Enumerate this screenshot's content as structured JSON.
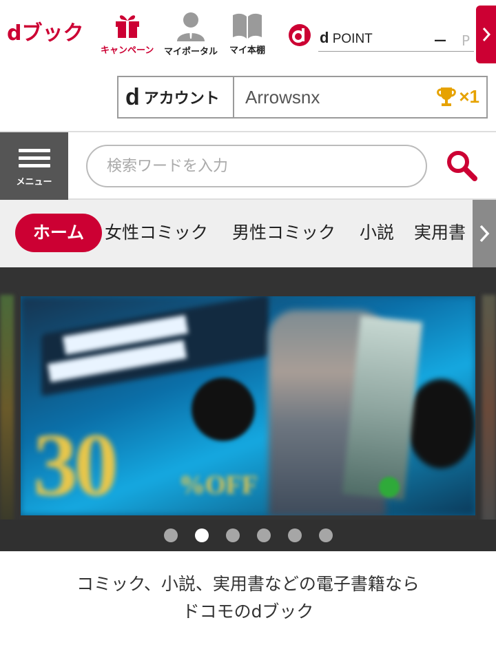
{
  "header": {
    "logo_text": "dブック",
    "nav": {
      "campaign_label": "キャンペーン",
      "portal_label": "マイポータル",
      "shelf_label": "マイ本棚"
    },
    "dpoint": {
      "label_prefix": "d",
      "label": "POINT",
      "value": "—",
      "unit": "P"
    }
  },
  "account": {
    "label_prefix": "d",
    "label": "アカウント",
    "username": "Arrowsnx",
    "trophy_count": "×1"
  },
  "search": {
    "menu_label": "メニュー",
    "placeholder": "検索ワードを入力"
  },
  "tabs": [
    {
      "label": "ホーム",
      "active": true
    },
    {
      "label": "女性コミック",
      "active": false
    },
    {
      "label": "男性コミック",
      "active": false
    },
    {
      "label": "小説",
      "active": false
    },
    {
      "label": "実用書",
      "active": false
    }
  ],
  "carousel": {
    "slide_count": 6,
    "active_index": 1,
    "banner": {
      "percent": "30",
      "off": "%OFF"
    }
  },
  "tagline": {
    "line1": "コミック、小説、実用書などの電子書籍なら",
    "line2": "ドコモのdブック"
  },
  "colors": {
    "brand_red": "#cc0033",
    "menu_gray": "#555555",
    "trophy_gold": "#e6a200"
  },
  "icons": {
    "campaign": "gift-icon",
    "portal": "user-icon",
    "shelf": "book-icon",
    "search": "magnifier-icon",
    "menu": "hamburger-icon",
    "trophy": "trophy-icon"
  }
}
